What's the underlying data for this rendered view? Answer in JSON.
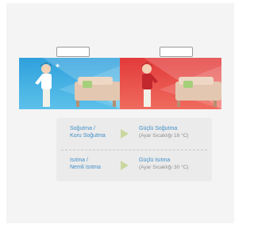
{
  "scenes": [
    {
      "name": "cooling-scene",
      "accent": "#2fa0dc"
    },
    {
      "name": "heating-scene",
      "accent": "#e23a3a"
    }
  ],
  "modes": [
    {
      "label_line1": "Soğutma /",
      "label_line2": "Kuru Soğutma",
      "result_title": "Güçlü Soğutma",
      "result_note": "(Ayar Sıcaklığı 18 °C)"
    },
    {
      "label_line1": "Isıtma /",
      "label_line2": "Nemli Isıtma",
      "result_title": "Güçlü Isıtma",
      "result_note": "(Ayar Sıcaklığı 30 °C)"
    }
  ],
  "colors": {
    "text_blue": "#3f8ec7",
    "arrow": "#c9d79e",
    "note_gray": "#8e8e8e"
  }
}
